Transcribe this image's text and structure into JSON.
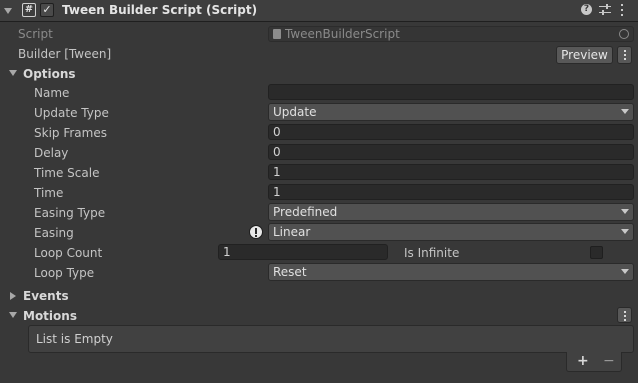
{
  "component": {
    "title": "Tween Builder Script (Script)",
    "enabled": true,
    "icons": [
      "script-hash-icon",
      "help-icon",
      "preset-sliders-icon",
      "kebab-menu-icon"
    ]
  },
  "script_field": {
    "label": "Script",
    "value": "TweenBuilderScript"
  },
  "builder": {
    "label": "Builder [Tween]",
    "preview_label": "Preview"
  },
  "options": {
    "label": "Options",
    "name": {
      "label": "Name",
      "value": ""
    },
    "update_type": {
      "label": "Update Type",
      "value": "Update"
    },
    "skip_frames": {
      "label": "Skip Frames",
      "value": "0"
    },
    "delay": {
      "label": "Delay",
      "value": "0"
    },
    "time_scale": {
      "label": "Time Scale",
      "value": "1"
    },
    "time": {
      "label": "Time",
      "value": "1"
    },
    "easing_type": {
      "label": "Easing Type",
      "value": "Predefined"
    },
    "easing": {
      "label": "Easing",
      "value": "Linear"
    },
    "loop_count": {
      "label": "Loop Count",
      "value": "1",
      "infinite_label": "Is Infinite",
      "is_infinite": false
    },
    "loop_type": {
      "label": "Loop Type",
      "value": "Reset"
    }
  },
  "events": {
    "label": "Events"
  },
  "motions": {
    "label": "Motions",
    "empty_text": "List is Empty",
    "add_label": "+",
    "remove_label": "−"
  },
  "colors": {
    "background": "#383838",
    "header": "#3e3e3e",
    "field": "#2a2a2a",
    "dropdown": "#515151"
  }
}
